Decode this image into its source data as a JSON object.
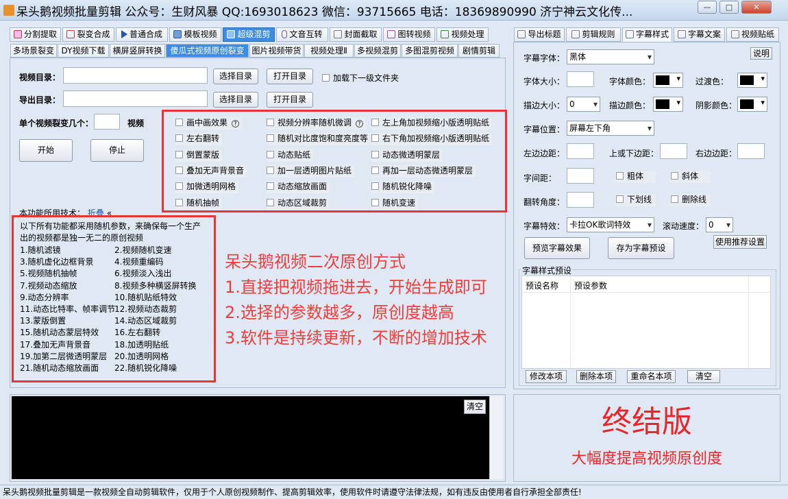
{
  "window": {
    "title": "呆头鹅视频批量剪辑 公众号：生财风暴 QQ:1693018623 微信：93715665 电话：18369890990 济宁神云文化传...",
    "controls": {
      "minimize": "—",
      "maximize": "□",
      "close": "✕"
    }
  },
  "main_tabs": [
    {
      "label": "分割提取",
      "icon": "split-icon"
    },
    {
      "label": "裂变合成",
      "icon": "fission-icon"
    },
    {
      "label": "普通合成",
      "icon": "play-icon"
    },
    {
      "label": "模板视频",
      "icon": "template-icon"
    },
    {
      "label": "超级混剪",
      "icon": "mix-icon",
      "active": true
    },
    {
      "label": "文音互转",
      "icon": "microphone-icon"
    },
    {
      "label": "封面截取",
      "icon": "image-icon"
    },
    {
      "label": "图转视频",
      "icon": "picture-video-icon"
    },
    {
      "label": "视频处理",
      "icon": "video-process-icon"
    }
  ],
  "sub_tabs": [
    {
      "label": "多场景裂变"
    },
    {
      "label": "DY视频下载"
    },
    {
      "label": "横屏竖屏转换"
    },
    {
      "label": "傻瓜式视频原创裂变",
      "active": true
    },
    {
      "label": "图片视频带货"
    },
    {
      "label": "视频处理Ⅱ"
    },
    {
      "label": "多视频混剪"
    },
    {
      "label": "多图混剪视频"
    },
    {
      "label": "剧情剪辑"
    }
  ],
  "form": {
    "video_dir_label": "视频目录：",
    "export_dir_label": "导出目录：",
    "video_dir_value": "",
    "export_dir_value": "",
    "select_dir": "选择目录",
    "open_dir": "打开目录",
    "load_subfolder": "加载下一级文件夹",
    "fission_count_label": "单个视频裂变几个：",
    "fission_count_value": "",
    "video_unit": "视频",
    "start": "开始",
    "stop": "停止"
  },
  "effect_options": [
    {
      "label": "画中画效果",
      "help": true
    },
    {
      "label": "视频分辨率随机微调",
      "help": true
    },
    {
      "label": "左上角加视频缩小版透明贴纸"
    },
    {
      "label": "左右翻转"
    },
    {
      "label": "随机对比度饱和度亮度等"
    },
    {
      "label": "右下角加视频缩小版透明贴纸"
    },
    {
      "label": "倒置蒙版"
    },
    {
      "label": "动态贴纸"
    },
    {
      "label": "动态微透明蒙层"
    },
    {
      "label": "叠加无声背景音"
    },
    {
      "label": "加一层透明图片贴纸"
    },
    {
      "label": "再加一层动态微透明蒙层"
    },
    {
      "label": "加微透明网格"
    },
    {
      "label": "动态缩放画面"
    },
    {
      "label": "随机锐化降噪"
    },
    {
      "label": "随机抽帧"
    },
    {
      "label": "动态区域裁剪"
    },
    {
      "label": "随机变速"
    }
  ],
  "tech": {
    "label": "本功能所用技术：",
    "collapse_link": "折叠",
    "collapse_icon": "«",
    "intro": "以下所有功能都采用随机参数，来确保每一个生产出的视频都是独一无二的原创视频",
    "items": [
      "1.随机滤镜",
      "2.视频随机变速",
      "3.随机虚化边框背景",
      "4.视频重编码",
      "5.视频随机抽帧",
      "6.视频淡入浅出",
      "7.视频动态缩放",
      "8.视频多种横竖屏转换",
      "9.动态分辨率",
      "10.随机贴纸特效",
      "11.动态比特率、帧率调节",
      "12.视频动态裁剪",
      "13.蒙版倒置",
      "14.动态区域裁剪",
      "15.随机动态蒙层特效",
      "16.左右翻转",
      "17.叠加无声背景音",
      "18.加透明贴纸",
      "19.加第二层微透明蒙层",
      "20.加透明网格",
      "21.随机动态缩放画面",
      "22.随机锐化降噪"
    ]
  },
  "promo": {
    "line1": "呆头鹅视频二次原创方式",
    "line2": "1.直接把视频拖进去，开始生成即可",
    "line3": "2.选择的参数越多，原创度越高",
    "line4": "3.软件是持续更新，不断的增加技术"
  },
  "log": {
    "clear": "清空"
  },
  "right_tabs": [
    {
      "label": "导出标题",
      "icon": "export-title-icon"
    },
    {
      "label": "剪辑规则",
      "icon": "rule-icon"
    },
    {
      "label": "字幕样式",
      "icon": "subtitle-style-icon",
      "active": true
    },
    {
      "label": "字幕文案",
      "icon": "edit-icon"
    },
    {
      "label": "视频贴纸",
      "icon": "star-icon"
    }
  ],
  "subtitle": {
    "help": "说明",
    "font_label": "字幕字体：",
    "font_value": "黑体",
    "size_label": "字体大小：",
    "size_value": "",
    "color_label": "字体颜色：",
    "transition_label": "过渡色：",
    "stroke_size_label": "描边大小：",
    "stroke_size_value": "0",
    "stroke_color_label": "描边颜色：",
    "shadow_color_label": "阴影颜色：",
    "position_label": "字幕位置：",
    "position_value": "屏幕左下角",
    "lr_margin_label": "左边边距：",
    "tb_margin_label": "上或下边距：",
    "right_margin_label": "右边边距：",
    "spacing_label": "字间距：",
    "bold": "粗体",
    "italic": "斜体",
    "rotate_label": "翻转角度：",
    "underline": "下划线",
    "strikethrough": "删除线",
    "effect_label": "字幕特效：",
    "effect_value": "卡拉OK歌词特效",
    "scroll_label": "滚动速度：",
    "scroll_value": "0",
    "preview": "预览字幕效果",
    "save_preset": "存为字幕预设",
    "use_recommended": "使用推荐设置",
    "color_swatch": "#000000"
  },
  "preset": {
    "title": "字幕样式预设",
    "columns": [
      "预设名称",
      "预设参数"
    ],
    "rows": [],
    "modify": "修改本项",
    "delete": "删除本项",
    "rename": "重命名本项",
    "clear": "清空"
  },
  "banner": {
    "title": "终结版",
    "subtitle": "大幅度提高视频原创度",
    "color": "#e8262a"
  },
  "status": "呆头鹅视频批量剪辑是一款视频全自动剪辑软件，仅用于个人原创视频制作、提高剪辑效率，使用软件时请遵守法律法规，如有违反由使用者自行承担全部责任!"
}
